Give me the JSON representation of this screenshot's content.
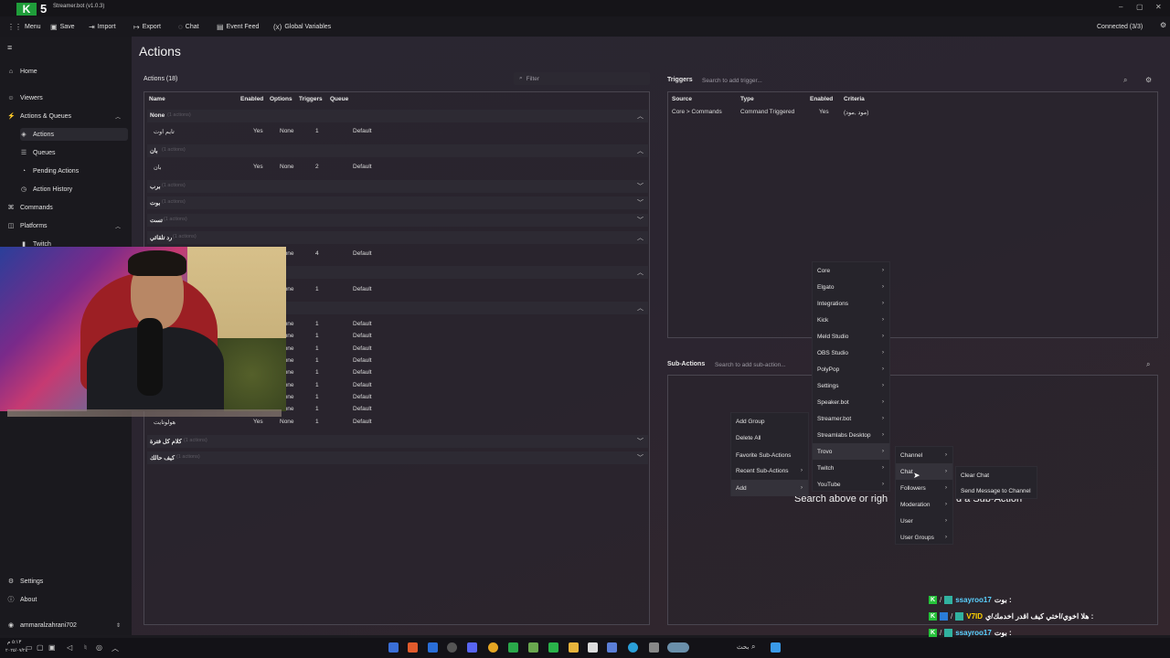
{
  "window": {
    "title": "Streamer.bot (v1.0.3)",
    "badge": "5"
  },
  "toolbar": {
    "menu": "Menu",
    "save": "Save",
    "import": "Import",
    "export": "Export",
    "chat": "Chat",
    "event_feed": "Event Feed",
    "global_vars": "Global Variables",
    "connection": "Connected (3/3)"
  },
  "sidebar": {
    "home": "Home",
    "viewers": "Viewers",
    "actions_queues": "Actions & Queues",
    "actions": "Actions",
    "queues": "Queues",
    "pending": "Pending Actions",
    "history": "Action History",
    "commands": "Commands",
    "platforms": "Platforms",
    "twitch": "Twitch",
    "settings": "Settings",
    "about": "About",
    "user": "ammaralzahrani702"
  },
  "page": {
    "title": "Actions"
  },
  "actions_panel": {
    "header": "Actions (18)",
    "filter_placeholder": "Filter",
    "columns": [
      "Name",
      "Enabled",
      "Options",
      "Triggers",
      "Queue"
    ],
    "groups": [
      {
        "name": "None",
        "count": "(1 actions)"
      },
      {
        "name": "بان",
        "count": "(1 actions)"
      },
      {
        "name": "برب",
        "count": "(1 actions)"
      },
      {
        "name": "بوت",
        "count": "(1 actions)"
      },
      {
        "name": "تست",
        "count": "(1 actions)"
      },
      {
        "name": "رد تلقائي",
        "count": "(1 actions)"
      },
      {
        "name": "كلام كل فترة",
        "count": "(1 actions)"
      },
      {
        "name": "كيف حالك",
        "count": "(1 actions)"
      }
    ],
    "rows": [
      {
        "name": "تايم اوت",
        "enabled": "Yes",
        "options": "None",
        "triggers": "1",
        "queue": "Default"
      },
      {
        "name": "بان",
        "enabled": "Yes",
        "options": "None",
        "triggers": "2",
        "queue": "Default"
      },
      {
        "name": "",
        "enabled": "",
        "options": "None",
        "triggers": "4",
        "queue": "Default"
      },
      {
        "name": "",
        "enabled": "",
        "options": "None",
        "triggers": "1",
        "queue": "Default"
      },
      {
        "name": "",
        "enabled": "",
        "options": "None",
        "triggers": "1",
        "queue": "Default"
      },
      {
        "name": "",
        "enabled": "",
        "options": "None",
        "triggers": "1",
        "queue": "Default"
      },
      {
        "name": "",
        "enabled": "",
        "options": "None",
        "triggers": "1",
        "queue": "Default"
      },
      {
        "name": "",
        "enabled": "",
        "options": "None",
        "triggers": "1",
        "queue": "Default"
      },
      {
        "name": "",
        "enabled": "",
        "options": "None",
        "triggers": "1",
        "queue": "Default"
      },
      {
        "name": "",
        "enabled": "",
        "options": "None",
        "triggers": "1",
        "queue": "Default"
      },
      {
        "name": "",
        "enabled": "",
        "options": "None",
        "triggers": "1",
        "queue": "Default"
      },
      {
        "name": "",
        "enabled": "",
        "options": "None",
        "triggers": "1",
        "queue": "Default"
      },
      {
        "name": "هولوتايت",
        "enabled": "Yes",
        "options": "None",
        "triggers": "1",
        "queue": "Default"
      }
    ]
  },
  "triggers_panel": {
    "header": "Triggers",
    "search_placeholder": "Search to add trigger...",
    "columns": [
      "Source",
      "Type",
      "Enabled",
      "Criteria"
    ],
    "row": {
      "source": "Core > Commands",
      "type": "Command Triggered",
      "enabled": "Yes",
      "criteria": "(مود ,مود)"
    }
  },
  "subactions_panel": {
    "header": "Sub-Actions",
    "search_placeholder": "Search to add sub-action...",
    "hint_left": "Search above or righ",
    "hint_right": "d a Sub-Action"
  },
  "context_menu": {
    "items": [
      "Add Group",
      "Delete All",
      "Favorite Sub-Actions",
      "Recent Sub-Actions",
      "Add"
    ]
  },
  "add_menu": {
    "items": [
      "Core",
      "Elgato",
      "Integrations",
      "Kick",
      "Meld Studio",
      "OBS Studio",
      "PolyPop",
      "Settings",
      "Speaker.bot",
      "Streamer.bot",
      "Streamlabs Desktop",
      "Trovo",
      "Twitch",
      "YouTube"
    ]
  },
  "trovo_menu": {
    "items": [
      "Channel",
      "Chat",
      "Followers",
      "Moderation",
      "User",
      "User Groups"
    ]
  },
  "chat_menu": {
    "items": [
      "Clear Chat",
      "Send Message to Channel"
    ]
  },
  "chat_overlay": [
    {
      "user": "ssayroo17",
      "msg": "بوت :"
    },
    {
      "user": "V7ID",
      "msg": "هلا اخوي/اختي كيف اقدر اخدمك/ي :"
    },
    {
      "user": "ssayroo17",
      "msg": "بوت :"
    },
    {
      "user": "V7ID",
      "msg": "هلا اخوي/اختي كيف اقدر اخدمك/ي :"
    }
  ],
  "taskbar": {
    "search": "بحث",
    "time": "٥:١٣ م",
    "date": "٢٠٢٥/٠٧/٢٤"
  },
  "colors": {
    "accent": "#25c23a",
    "panel_border": "#4a4650",
    "menu_bg": "#26242b"
  }
}
